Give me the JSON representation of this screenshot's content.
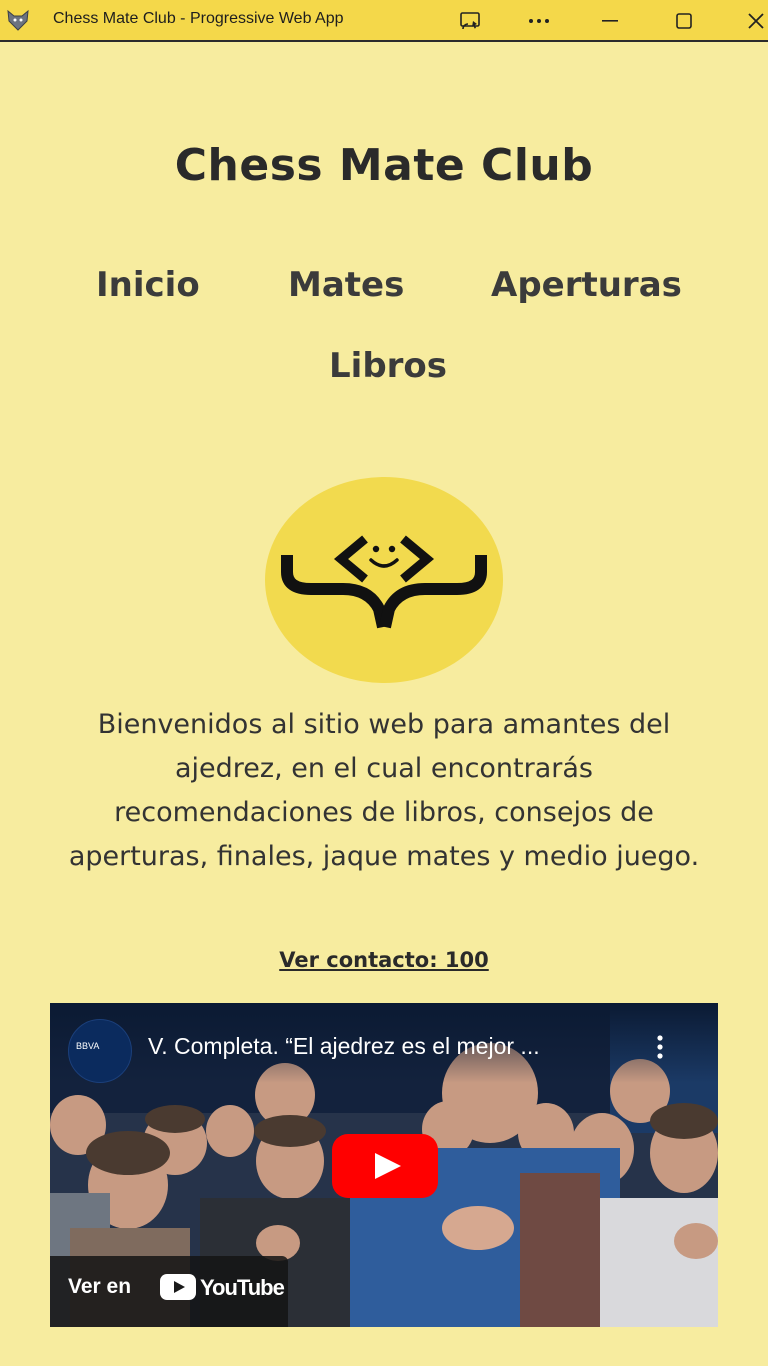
{
  "window": {
    "title": "Chess Mate Club - Progressive Web App",
    "icons": [
      "app-wolf-icon",
      "cast-icon",
      "more-options-icon",
      "minimize-icon",
      "maximize-icon",
      "close-icon"
    ]
  },
  "site": {
    "title": "Chess Mate Club"
  },
  "nav": {
    "items": [
      "Inicio",
      "Mates",
      "Aperturas",
      "Libros"
    ]
  },
  "logo": {
    "icon": "code-reader-logo-icon",
    "circle_color": "#f2da4e"
  },
  "intro": {
    "text": "Bienvenidos al sitio web para amantes del ajedrez, en el cual encontrarás recomendaciones de libros, consejos de aperturas, finales, jaque mates y medio juego."
  },
  "contact": {
    "label": "Ver contacto: 100"
  },
  "video": {
    "title": "V. Completa. “El ajedrez es el mejor ...",
    "channel_avatar_text": "BBVA",
    "watch_on_label": "Ver en",
    "brand": "YouTube",
    "play_color": "#ff0000"
  },
  "colors": {
    "page_background": "#f7ec9f",
    "titlebar_background": "#f4d84a",
    "text": "#2e2e2e"
  }
}
